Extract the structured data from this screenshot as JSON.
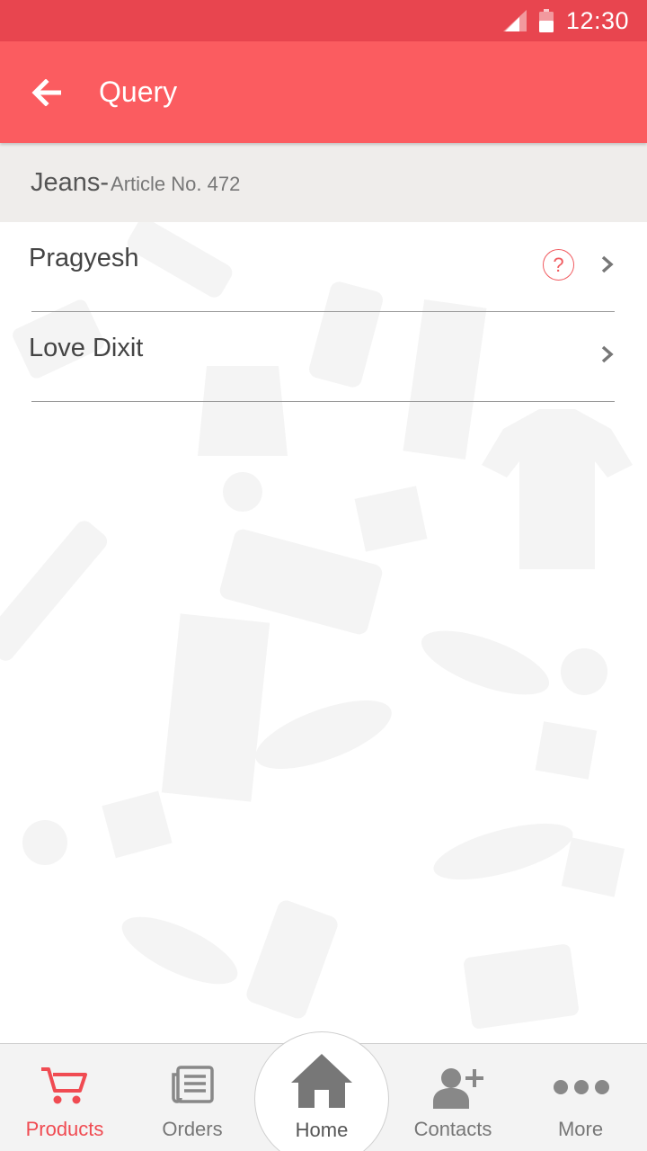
{
  "status_bar": {
    "time": "12:30",
    "signal_icon": "signal-icon",
    "battery_icon": "battery-icon"
  },
  "app_bar": {
    "back_icon": "arrow-left-icon",
    "title": "Query"
  },
  "product": {
    "name": "Jeans-",
    "article": "Article No. 472"
  },
  "queries": [
    {
      "name": "Pragyesh",
      "badge": "?",
      "has_badge": true
    },
    {
      "name": "Love Dixit",
      "has_badge": false
    }
  ],
  "bottom_nav": {
    "products": "Products",
    "orders": "Orders",
    "home": "Home",
    "contacts": "Contacts",
    "more": "More"
  },
  "colors": {
    "status_bar": "#e8454f",
    "app_bar": "#fb5c60",
    "accent": "#f04b52",
    "header_bg": "#efedeb",
    "nav_bg": "#f3f3f3"
  }
}
